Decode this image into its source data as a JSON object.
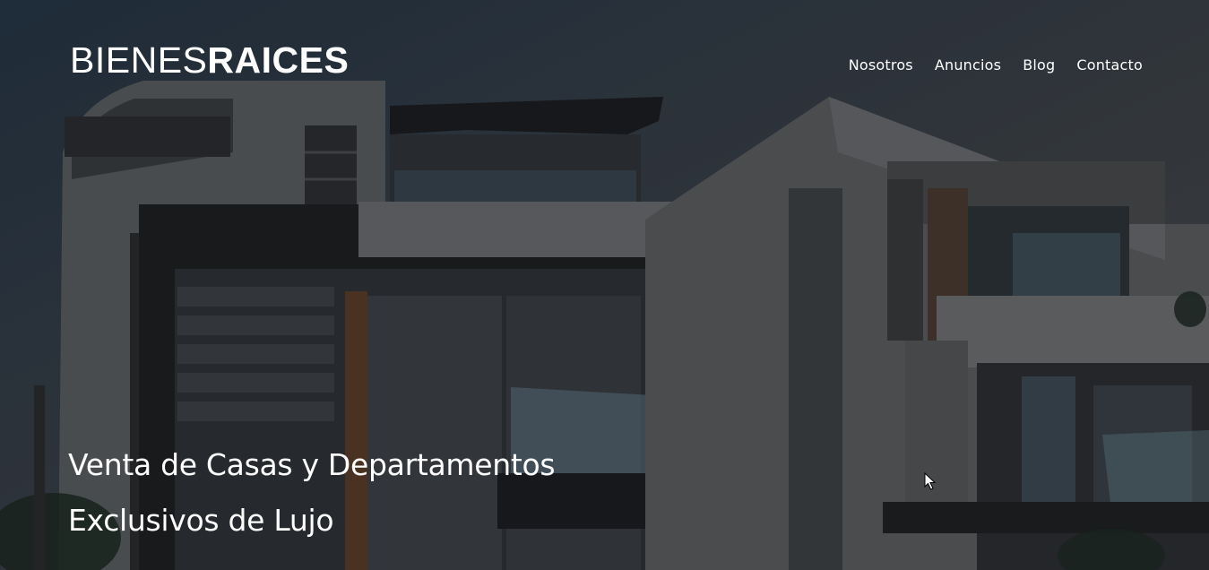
{
  "header": {
    "logo_light": "BIENES",
    "logo_bold": "RAICES"
  },
  "nav": {
    "items": [
      {
        "label": "Nosotros"
      },
      {
        "label": "Anuncios"
      },
      {
        "label": "Blog"
      },
      {
        "label": "Contacto"
      }
    ]
  },
  "hero": {
    "headline": "Venta de Casas y Departamentos Exclusivos de Lujo",
    "background_image": "modern-houses-photo"
  },
  "colors": {
    "text": "#ffffff",
    "overlay": "#000000"
  }
}
